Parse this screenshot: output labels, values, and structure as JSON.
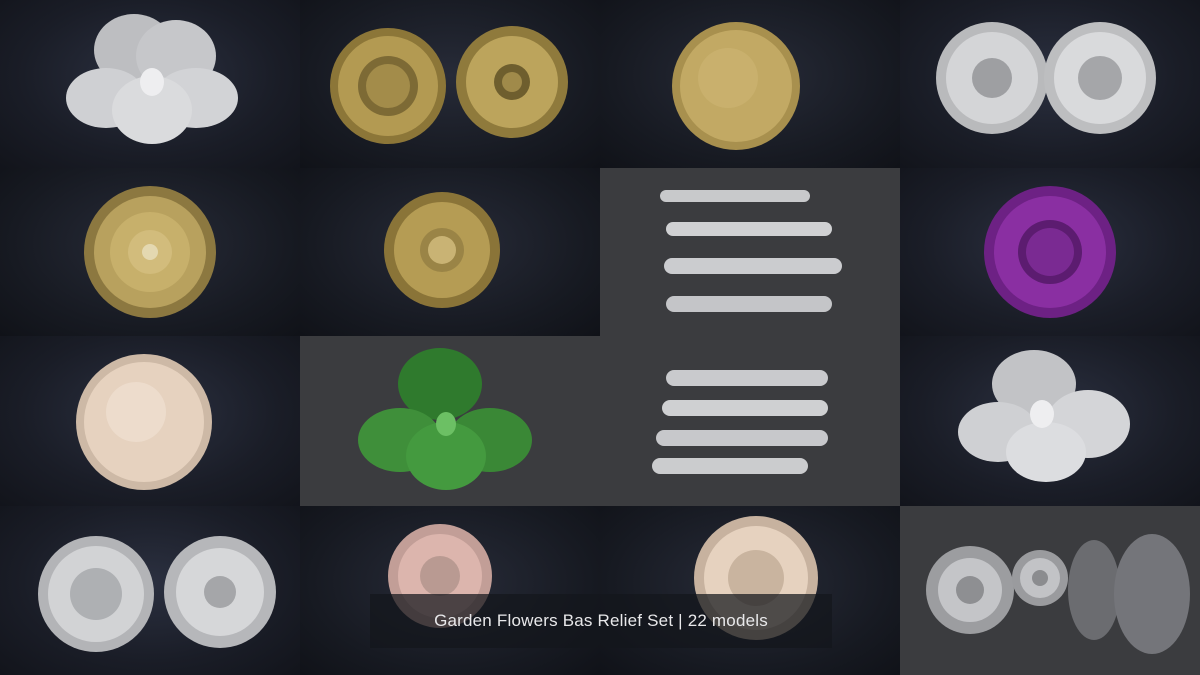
{
  "caption": {
    "text": "Garden Flowers Bas Relief Set | 22 models"
  },
  "colors": {
    "silver": "#c9cacc",
    "gold": "#b39a52",
    "cream": "#e6d2bf",
    "green": "#3f8f3a",
    "purple": "#8a2fa2",
    "pink": "#dcb5ad",
    "background_dark": "#1a1d26",
    "background_gray": "#3b3c3f"
  },
  "tiles": [
    {
      "id": "white-pansy",
      "icon": "pansy-flower",
      "color": "silver"
    },
    {
      "id": "gold-sunflower-pair",
      "icon": "sunflower-pair",
      "color": "gold"
    },
    {
      "id": "gold-seed-dome",
      "icon": "seed-dome",
      "color": "gold"
    },
    {
      "id": "white-daisy-pair",
      "icon": "daisy-pair",
      "color": "silver"
    },
    {
      "id": "gold-dahlia",
      "icon": "dahlia-flower",
      "color": "gold"
    },
    {
      "id": "gold-sunflower",
      "icon": "sunflower",
      "color": "gold"
    },
    {
      "id": "side-profiles-top",
      "icon": "side-profile-stack",
      "color": "silver"
    },
    {
      "id": "purple-sunflower",
      "icon": "sunflower",
      "color": "purple"
    },
    {
      "id": "cream-seed-dome",
      "icon": "seed-dome",
      "color": "cream"
    },
    {
      "id": "green-pansy",
      "icon": "pansy-flower",
      "color": "green"
    },
    {
      "id": "side-profiles-bottom",
      "icon": "side-profile-stack",
      "color": "silver"
    },
    {
      "id": "white-pansy-large",
      "icon": "pansy-flower",
      "color": "silver"
    },
    {
      "id": "white-sunflower-pair",
      "icon": "sunflower-pair",
      "color": "silver"
    },
    {
      "id": "pink-sunflower",
      "icon": "sunflower",
      "color": "pink"
    },
    {
      "id": "cream-sunflower",
      "icon": "sunflower",
      "color": "cream"
    },
    {
      "id": "daisy-depth-maps",
      "icon": "depth-map-set",
      "color": "silver"
    }
  ]
}
